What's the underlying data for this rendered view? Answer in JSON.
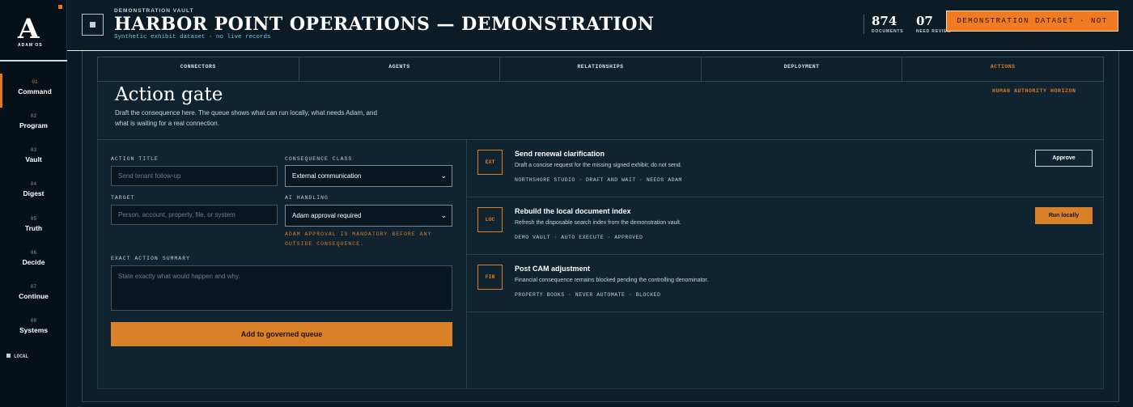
{
  "sidebar": {
    "logo_mark": "A",
    "logo_name": "ADAM OS",
    "items": [
      {
        "num": "01",
        "label": "Command"
      },
      {
        "num": "02",
        "label": "Program"
      },
      {
        "num": "03",
        "label": "Vault"
      },
      {
        "num": "04",
        "label": "Digest"
      },
      {
        "num": "05",
        "label": "Truth"
      },
      {
        "num": "06",
        "label": "Decide"
      },
      {
        "num": "07",
        "label": "Continue"
      },
      {
        "num": "08",
        "label": "Systems"
      }
    ],
    "active_index": 0,
    "status": "LOCAL"
  },
  "header": {
    "eyebrow": "DEMONSTRATION VAULT",
    "title": "HARBOR POINT OPERATIONS — DEMONSTRATION",
    "subtitle": "Synthetic exhibit dataset · no live records",
    "metrics": [
      {
        "value": "874",
        "label": "DOCUMENTS"
      },
      {
        "value": "07",
        "label": "NEED REVIEW"
      }
    ],
    "badge": "DEMONSTRATION DATASET · NOT LIVE"
  },
  "tabs": [
    "CONNECTORS",
    "AGENTS",
    "RELATIONSHIPS",
    "DEPLOYMENT",
    "ACTIONS"
  ],
  "active_tab": "ACTIONS",
  "action_gate": {
    "title": "Action gate",
    "description": "Draft the consequence here. The queue shows what can run locally, what needs Adam, and what is waiting for a real connection.",
    "horizon_label": "HUMAN AUTHORITY HORIZON"
  },
  "form": {
    "action_title_label": "ACTION TITLE",
    "action_title_placeholder": "Send tenant follow-up",
    "consequence_label": "CONSEQUENCE CLASS",
    "consequence_value": "External communication",
    "target_label": "TARGET",
    "target_placeholder": "Person, account, property, file, or system",
    "ai_handling_label": "AI HANDLING",
    "ai_handling_value": "Adam approval required",
    "warning": "ADAM APPROVAL IS MANDATORY BEFORE ANY OUTSIDE CONSEQUENCE.",
    "summary_label": "EXACT ACTION SUMMARY",
    "summary_placeholder": "State exactly what would happen and why.",
    "submit_label": "Add to governed queue"
  },
  "queue": [
    {
      "code": "EXT",
      "title": "Send renewal clarification",
      "description": "Draft a concise request for the missing signed exhibit; do not send.",
      "meta": "NORTHSHORE STUDIO · DRAFT AND WAIT · NEEDS ADAM",
      "button": "Approve"
    },
    {
      "code": "LOC",
      "title": "Rebuild the local document index",
      "description": "Refresh the disposable search index from the demonstration vault.",
      "meta": "DEMO VAULT · AUTO EXECUTE · APPROVED",
      "button": "Run locally"
    },
    {
      "code": "FIN",
      "title": "Post CAM adjustment",
      "description": "Financial consequence remains blocked pending the controlling denominator.",
      "meta": "PROPERTY BOOKS · NEVER AUTOMATE · BLOCKED"
    }
  ],
  "colors": {
    "accent": "#e07b22",
    "background": "#0a1a24",
    "panel": "#0f2330"
  }
}
